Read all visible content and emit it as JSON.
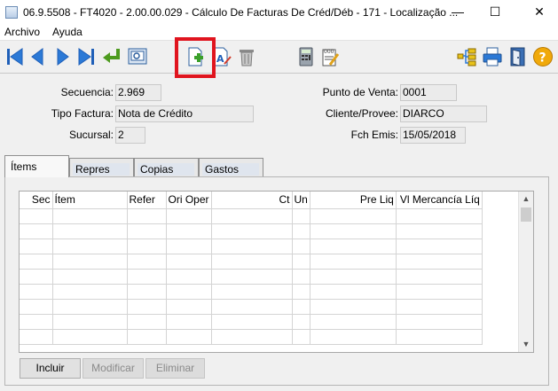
{
  "window": {
    "title": "06.9.5508 - FT4020 - 2.00.00.029 - Cálculo De Facturas De Créd/Déb - 171 - Localização ...",
    "minimize": "—",
    "maximize": "☐",
    "close": "✕"
  },
  "menu": {
    "items": [
      "Archivo",
      "Ayuda"
    ]
  },
  "toolbar": {
    "buttons": [
      "first-record-icon",
      "previous-record-icon",
      "next-record-icon",
      "last-record-icon",
      "return-arrow-icon",
      "preview-icon",
      "new-document-icon",
      "edit-text-icon",
      "trash-icon",
      "calculator-icon",
      "document-numbers-icon",
      "tree-structure-icon",
      "printer-icon",
      "exit-door-icon",
      "help-icon"
    ],
    "highlight_color": "#e0141e"
  },
  "header": {
    "secuencia_label": "Secuencia:",
    "secuencia_value": "2.969",
    "tipo_label": "Tipo Factura:",
    "tipo_value": "Nota de Crédito",
    "sucursal_label": "Sucursal:",
    "sucursal_value": "2",
    "pv_label": "Punto de Venta:",
    "pv_value": "0001",
    "cliente_label": "Cliente/Provee:",
    "cliente_value": "DIARCO",
    "fch_label": "Fch Emis:",
    "fch_value": "15/05/2018"
  },
  "tabs": [
    "Ítems",
    "Repres",
    "Copias",
    "Gastos"
  ],
  "grid": {
    "columns": [
      "Sec",
      "Ítem",
      "Refer",
      "Ori Oper",
      "Ct",
      "Un",
      "Pre Liq",
      "Vl Mercancía Líq"
    ],
    "rows": 9
  },
  "buttons": {
    "incluir": "Incluir",
    "modificar": "Modificar",
    "eliminar": "Eliminar"
  }
}
